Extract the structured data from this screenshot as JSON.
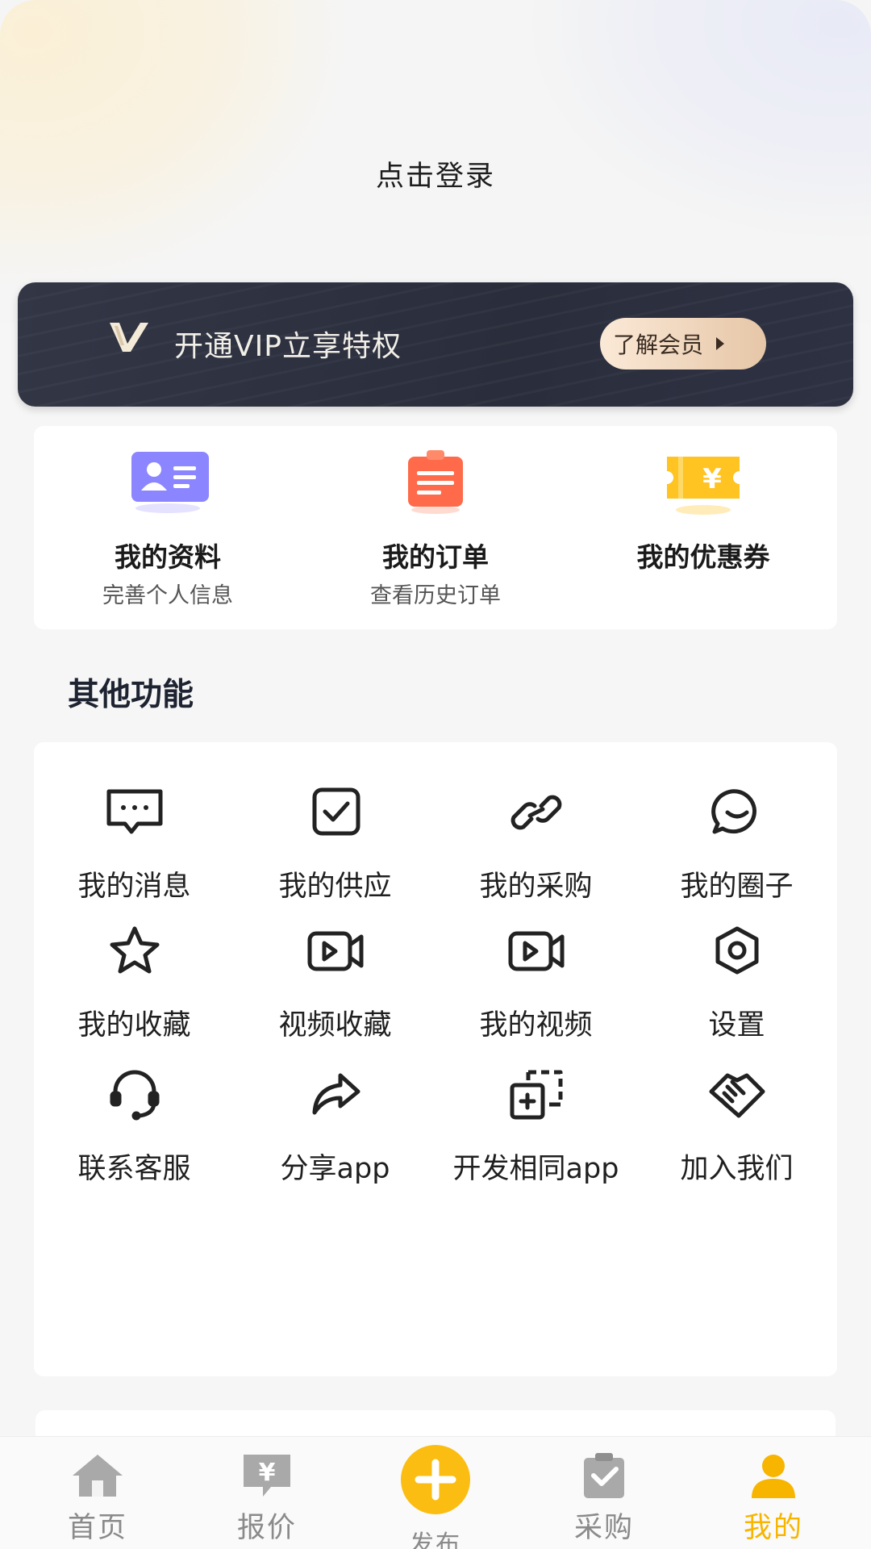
{
  "header": {
    "login_text": "点击登录"
  },
  "vip_banner": {
    "title": "开通VIP立享特权",
    "button_label": "了解会员"
  },
  "quick_actions": [
    {
      "title": "我的资料",
      "subtitle": "完善个人信息",
      "icon": "profile-card-icon"
    },
    {
      "title": "我的订单",
      "subtitle": "查看历史订单",
      "icon": "order-clipboard-icon"
    },
    {
      "title": "我的优惠券",
      "subtitle": "",
      "icon": "coupon-yen-icon"
    }
  ],
  "other_functions": {
    "title": "其他功能",
    "items": [
      {
        "label": "我的消息",
        "icon": "message-icon"
      },
      {
        "label": "我的供应",
        "icon": "checkbox-icon"
      },
      {
        "label": "我的采购",
        "icon": "link-icon"
      },
      {
        "label": "我的圈子",
        "icon": "chat-bubble-icon"
      },
      {
        "label": "我的收藏",
        "icon": "star-icon"
      },
      {
        "label": "视频收藏",
        "icon": "video-camera-icon"
      },
      {
        "label": "我的视频",
        "icon": "video-camera-icon"
      },
      {
        "label": "设置",
        "icon": "settings-icon"
      },
      {
        "label": "联系客服",
        "icon": "headset-icon"
      },
      {
        "label": "分享app",
        "icon": "share-icon"
      },
      {
        "label": "开发相同app",
        "icon": "copy-icon"
      },
      {
        "label": "加入我们",
        "icon": "handshake-icon"
      }
    ]
  },
  "tabbar": {
    "items": [
      {
        "label": "首页",
        "icon": "home-icon",
        "active": false
      },
      {
        "label": "报价",
        "icon": "quote-yen-icon",
        "active": false
      },
      {
        "label": "发布",
        "icon": "plus-icon",
        "active": false
      },
      {
        "label": "采购",
        "icon": "purchase-icon",
        "active": false
      },
      {
        "label": "我的",
        "icon": "user-icon",
        "active": true
      }
    ],
    "active_color": "#f7b500",
    "inactive_color": "#8a8a8a"
  }
}
